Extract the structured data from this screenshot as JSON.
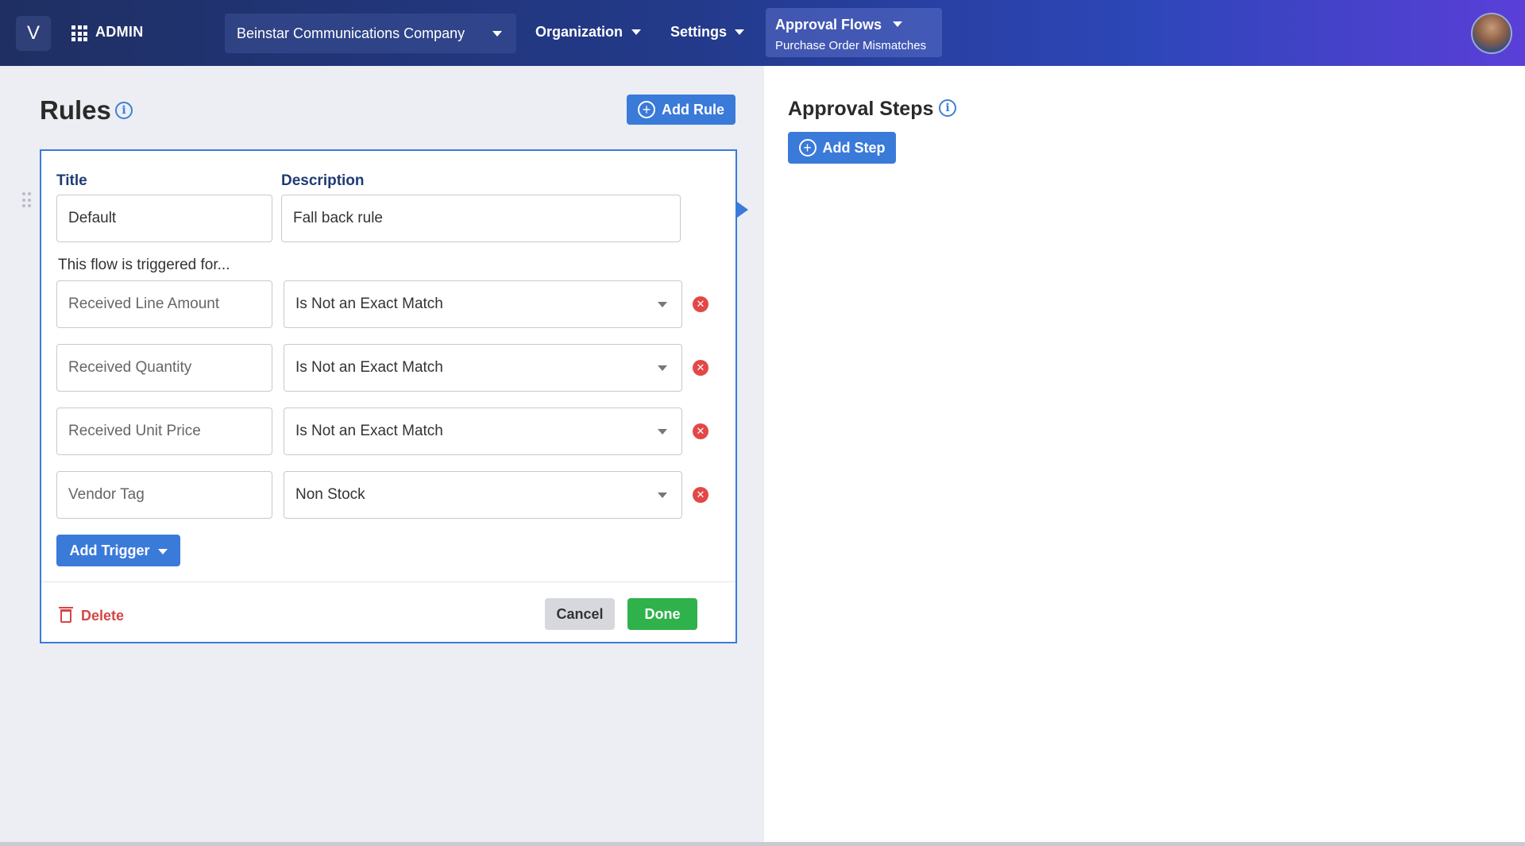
{
  "header": {
    "logo": "V",
    "admin_label": "ADMIN",
    "company": "Beinstar Communications Company",
    "nav": {
      "organization": "Organization",
      "settings": "Settings"
    },
    "approval": {
      "title": "Approval Flows",
      "subtitle": "Purchase Order Mismatches"
    }
  },
  "rules": {
    "title": "Rules",
    "add_rule": "Add Rule",
    "card": {
      "title_label": "Title",
      "description_label": "Description",
      "title_value": "Default",
      "description_value": "Fall back rule",
      "triggered_text": "This flow is triggered for...",
      "triggers": [
        {
          "field": "Received Line Amount",
          "condition": "Is Not an Exact Match"
        },
        {
          "field": "Received Quantity",
          "condition": "Is Not an Exact Match"
        },
        {
          "field": "Received Unit Price",
          "condition": "Is Not an Exact Match"
        },
        {
          "field": "Vendor Tag",
          "condition": "Non Stock"
        }
      ],
      "add_trigger": "Add Trigger",
      "delete": "Delete",
      "cancel": "Cancel",
      "done": "Done"
    }
  },
  "approval_steps": {
    "title": "Approval Steps",
    "add_step": "Add Step"
  },
  "colors": {
    "accent": "#3a7ad9",
    "done": "#2fb24b",
    "danger": "#e24848"
  }
}
